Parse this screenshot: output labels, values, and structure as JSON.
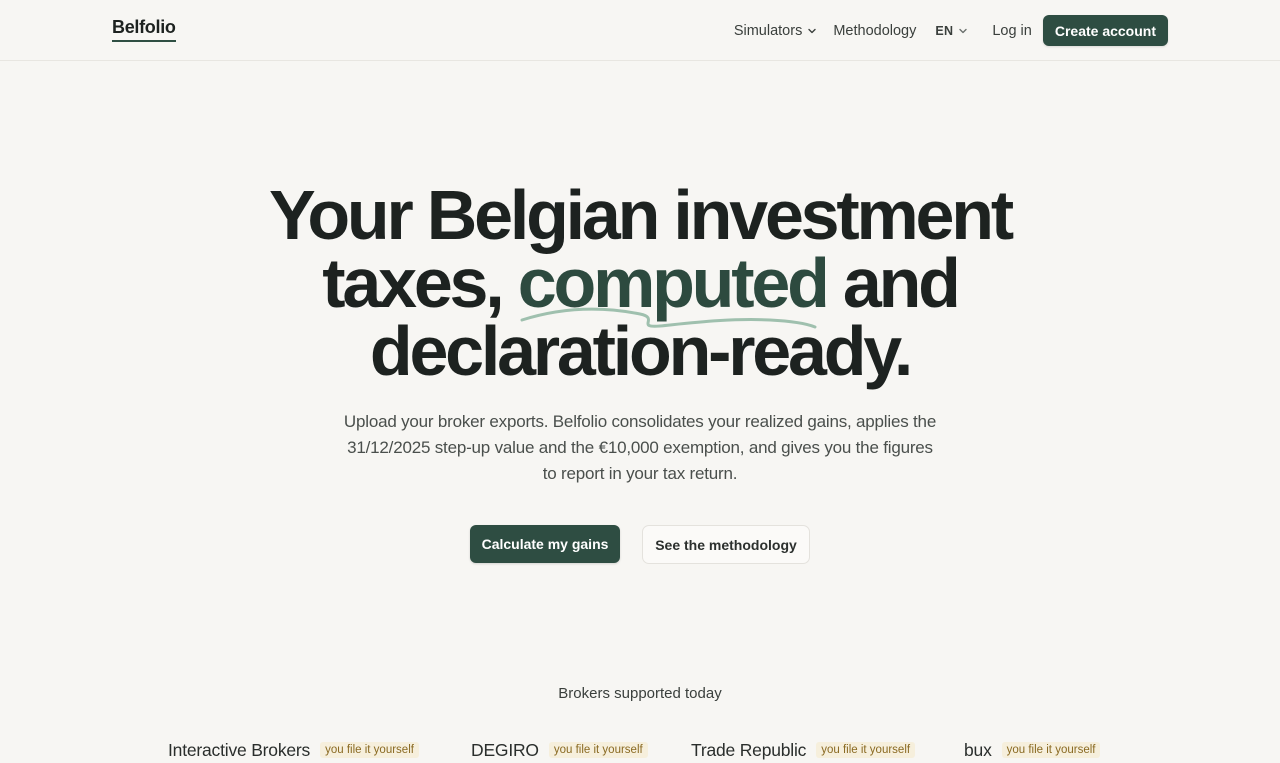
{
  "header": {
    "logo": "Belfolio",
    "nav": {
      "simulators": "Simulators",
      "methodology": "Methodology",
      "language": "EN",
      "login": "Log in",
      "create_account": "Create account"
    }
  },
  "hero": {
    "title_line1": "Your Belgian investment",
    "title_line2_before": "taxes, ",
    "title_line2_accent": "computed",
    "title_line2_after": " and",
    "title_line3": "declaration-ready.",
    "subtitle": "Upload your broker exports. Belfolio consolidates your realized gains, applies the 31/12/2025 step-up value and the €10,000 exemption, and gives you the figures to report in your tax return.",
    "primary_cta": "Calculate my gains",
    "secondary_cta": "See the methodology"
  },
  "brokers": {
    "heading": "Brokers supported today",
    "items": [
      {
        "name": "Interactive Brokers",
        "badge": "you file it yourself"
      },
      {
        "name": "DEGIRO",
        "badge": "you file it yourself"
      },
      {
        "name": "Trade Republic",
        "badge": "you file it yourself"
      },
      {
        "name": "bux",
        "badge": "you file it yourself"
      }
    ]
  },
  "colors": {
    "background": "#f7f6f3",
    "brand_green": "#2e4d42",
    "text_dark": "#1d2220",
    "badge_bg": "#f6efdc",
    "badge_text": "#8a6a22"
  },
  "icons": [
    "chevron-down-icon"
  ]
}
